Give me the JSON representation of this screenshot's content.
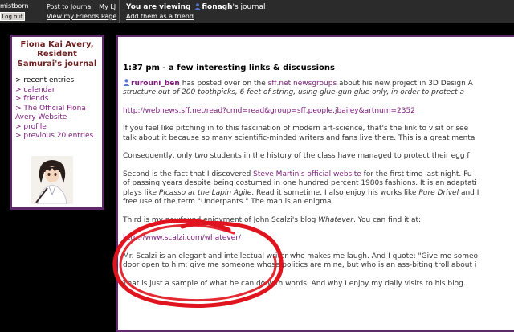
{
  "topbar": {
    "username": "mistborn",
    "logout": "Log out",
    "post_link": "Post to Journal",
    "mylj_link": "My LJ",
    "friends_link": "View my Friends Page",
    "viewing_label": "You are viewing",
    "viewing_user": "fionagh",
    "viewing_suffix": "'s journal",
    "add_friend": "Add them as a friend"
  },
  "sidebar": {
    "title": "Fiona Kai Avery, Resident Samurai's journal",
    "nav": [
      {
        "label": "> recent entries",
        "link": false
      },
      {
        "label": "> calendar",
        "link": true
      },
      {
        "label": "> friends",
        "link": true
      },
      {
        "label": "> The Official Fiona Avery Website",
        "link": true
      },
      {
        "label": "> profile",
        "link": true
      },
      {
        "label": "> previous 20 entries",
        "link": true
      }
    ]
  },
  "entry": {
    "header": "1:37 pm - a few interesting links & discussions",
    "p1_user": "rurouni_ben",
    "p1_a": " has posted over on the ",
    "p1_link": "sff.net newsgroups",
    "p1_b": " about his new project in 3D Design A",
    "p1_line2": "structure out of 200 toothpicks, 6 feet of string, using glue-gun glue only, in order to protect a",
    "url1": "http://webnews.sff.net/read?cmd=read&group=sff.people.jbailey&artnum=2352",
    "p2_line1": "If you feel like pitching in to this fascination of modern art-science, that's the link to visit or see",
    "p2_line2": "talk about it because so many scientific-minded writers and fans live there. This is a great menta",
    "p3": "Consequently, only two students in the history of the class have managed to protect their egg f",
    "p4_a": "Second is the fact that I discovered ",
    "p4_link": "Steve Martin's official website",
    "p4_b": " for the first time last night. Fu",
    "p4_line2": "of passing years despite being costumed in one hundred percent 1980s fashions. It is an adaptati",
    "p4_line3a": "plays like ",
    "p4_line3b": "Picasso at the Lapin Agile",
    "p4_line3c": ". Read it sometime. I also enjoy his works like ",
    "p4_line3d": "Pure Drivel",
    "p4_line3e": " and I",
    "p4_line4": "free use of the term \"Underpants.\" The man is an enigma.",
    "p5_a": "Third is my newfound enjoyment of John Scalzi's blog ",
    "p5_it": "Whatever",
    "p5_b": ". You can find it at:",
    "url2": "http://www.scalzi.com/whatever/",
    "p6_line1": "Mr. Scalzi is an elegant and intellectual writer who makes me laugh. And I quote: \"Give me someo",
    "p6_line2": "door open to him; give me someone whose politics are mine, but who is an ass-biting troll about i",
    "p7": "That is just a sample of what he can do with words. And why I enjoy my daily visits to his blog."
  },
  "colors": {
    "frame": "#5f2a6b",
    "link": "#7a1a7a",
    "title": "#6b1f1f",
    "annotation": "#e0141e"
  }
}
